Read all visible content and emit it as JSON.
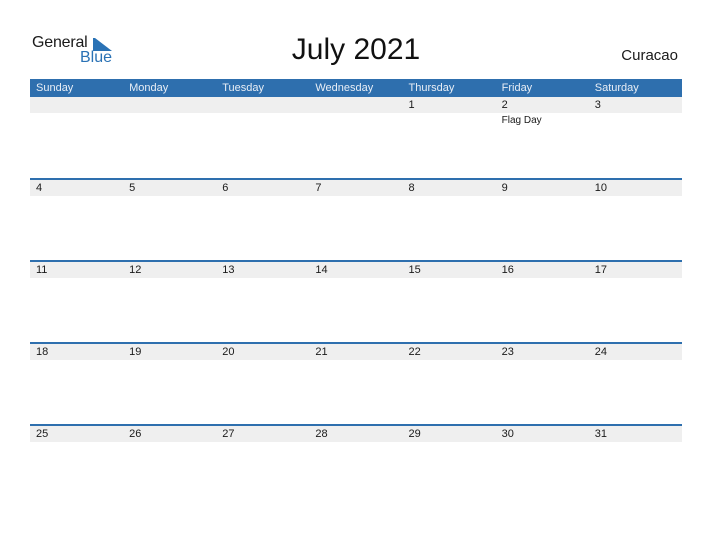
{
  "logo": {
    "line1": "General",
    "line2": "Blue"
  },
  "title": "July 2021",
  "country": "Curacao",
  "colors": {
    "accent": "#2e6fae",
    "date_bar": "#efefef",
    "logo_blue": "#2a72b5"
  },
  "weekdays": [
    "Sunday",
    "Monday",
    "Tuesday",
    "Wednesday",
    "Thursday",
    "Friday",
    "Saturday"
  ],
  "weeks": [
    [
      {
        "d": ""
      },
      {
        "d": ""
      },
      {
        "d": ""
      },
      {
        "d": ""
      },
      {
        "d": "1"
      },
      {
        "d": "2",
        "event": "Flag Day"
      },
      {
        "d": "3"
      }
    ],
    [
      {
        "d": "4"
      },
      {
        "d": "5"
      },
      {
        "d": "6"
      },
      {
        "d": "7"
      },
      {
        "d": "8"
      },
      {
        "d": "9"
      },
      {
        "d": "10"
      }
    ],
    [
      {
        "d": "11"
      },
      {
        "d": "12"
      },
      {
        "d": "13"
      },
      {
        "d": "14"
      },
      {
        "d": "15"
      },
      {
        "d": "16"
      },
      {
        "d": "17"
      }
    ],
    [
      {
        "d": "18"
      },
      {
        "d": "19"
      },
      {
        "d": "20"
      },
      {
        "d": "21"
      },
      {
        "d": "22"
      },
      {
        "d": "23"
      },
      {
        "d": "24"
      }
    ],
    [
      {
        "d": "25"
      },
      {
        "d": "26"
      },
      {
        "d": "27"
      },
      {
        "d": "28"
      },
      {
        "d": "29"
      },
      {
        "d": "30"
      },
      {
        "d": "31"
      }
    ]
  ]
}
